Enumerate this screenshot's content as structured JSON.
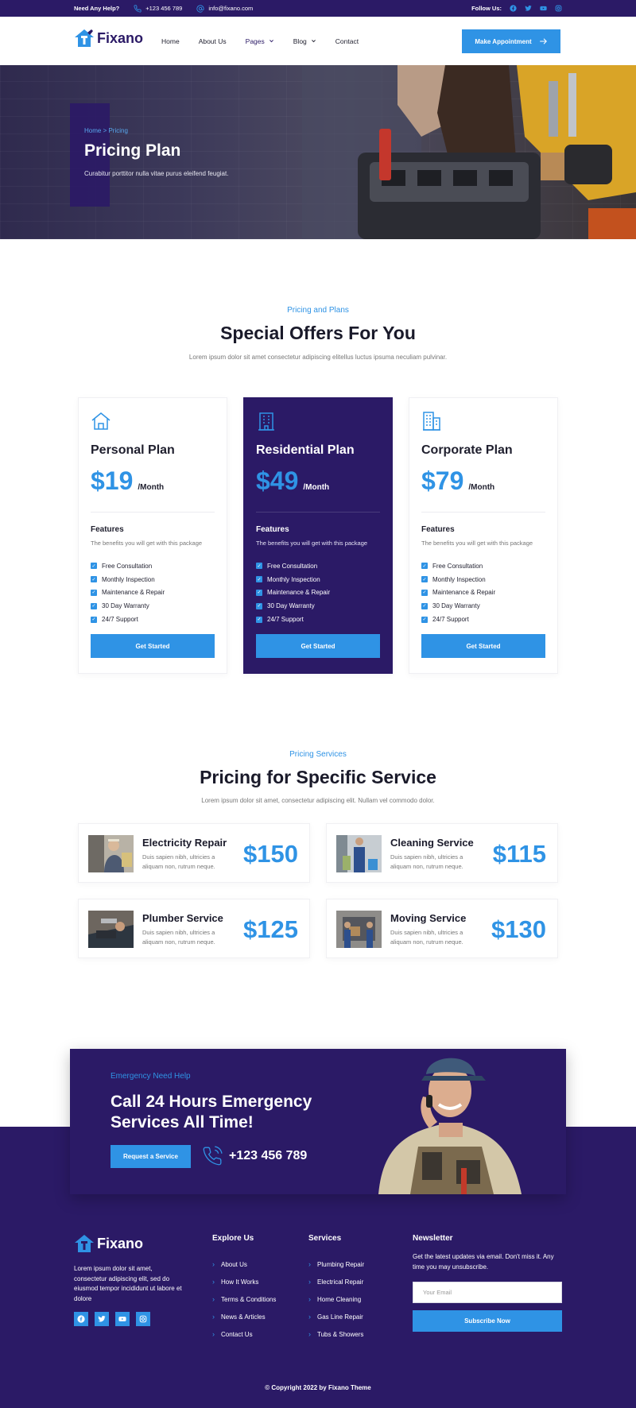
{
  "topbar": {
    "help_label": "Need Any Help?",
    "phone": "+123 456 789",
    "email": "info@fixano.com",
    "follow_label": "Follow Us:",
    "social_icons": [
      "facebook-icon",
      "twitter-icon",
      "youtube-icon",
      "instagram-icon"
    ]
  },
  "nav": {
    "logo": "Fixano",
    "items": [
      {
        "label": "Home"
      },
      {
        "label": "About Us"
      },
      {
        "label": "Pages"
      },
      {
        "label": "Blog"
      },
      {
        "label": "Contact"
      }
    ],
    "cta": "Make Appointment"
  },
  "hero": {
    "breadcrumb": "Home > Pricing",
    "title": "Pricing Plan",
    "subtitle": "Curabitur porttitor nulla vitae purus eleifend feugiat."
  },
  "pricing": {
    "tag": "Pricing and Plans",
    "title": "Special Offers For You",
    "desc": "Lorem ipsum dolor sit amet consectetur adipiscing elitellus luctus ipsuma neculiam pulvinar.",
    "plans": [
      {
        "icon": "house-icon",
        "name": "Personal Plan",
        "price": "$19",
        "period": "/Month",
        "features_title": "Features",
        "features_desc": "The benefits you will get with this package",
        "features": [
          "Free Consultation",
          "Monthly Inspection",
          "Maintenance & Repair",
          "30 Day Warranty",
          "24/7 Support"
        ],
        "button": "Get Started"
      },
      {
        "icon": "apartment-icon",
        "name": "Residential Plan",
        "price": "$49",
        "period": "/Month",
        "features_title": "Features",
        "features_desc": "The benefits you will get with this package",
        "features": [
          "Free Consultation",
          "Monthly Inspection",
          "Maintenance & Repair",
          "30 Day Warranty",
          "24/7 Support"
        ],
        "button": "Get Started"
      },
      {
        "icon": "office-buildings-icon",
        "name": "Corporate Plan",
        "price": "$79",
        "period": "/Month",
        "features_title": "Features",
        "features_desc": "The benefits you will get with this package",
        "features": [
          "Free Consultation",
          "Monthly Inspection",
          "Maintenance & Repair",
          "30 Day Warranty",
          "24/7 Support"
        ],
        "button": "Get Started"
      }
    ]
  },
  "services": {
    "tag": "Pricing Services",
    "title": "Pricing for Specific Service",
    "desc": "Lorem ipsum dolor sit amet, consectetur adipiscing elit. Nullam vel commodo dolor.",
    "items": [
      {
        "name": "Electricity Repair",
        "desc": "Duis sapien nibh, ultricies a aliquam non, rutrum neque.",
        "price": "$150"
      },
      {
        "name": "Cleaning Service",
        "desc": "Duis sapien nibh, ultricies a aliquam non, rutrum neque.",
        "price": "$115"
      },
      {
        "name": "Plumber Service",
        "desc": "Duis sapien nibh, ultricies a aliquam non, rutrum neque.",
        "price": "$125"
      },
      {
        "name": "Moving Service",
        "desc": "Duis sapien nibh, ultricies a aliquam non, rutrum neque.",
        "price": "$130"
      }
    ]
  },
  "cta": {
    "tag": "Emergency Need Help",
    "title": "Call 24 Hours Emergency Services All Time!",
    "button": "Request a Service",
    "phone": "+123 456 789"
  },
  "footer": {
    "logo": "Fixano",
    "about": "Lorem ipsum dolor sit amet, consectetur adipiscing elit, sed do eiusmod tempor incididunt ut labore et dolore",
    "explore_title": "Explore Us",
    "explore_links": [
      "About Us",
      "How It Works",
      "Terms & Conditions",
      "News & Articles",
      "Contact Us"
    ],
    "services_title": "Services",
    "services_links": [
      "Plumbing Repair",
      "Electrical Repair",
      "Home Cleaning",
      "Gas Line Repair",
      "Tubs & Showers"
    ],
    "newsletter_title": "Newsletter",
    "newsletter_desc": "Get the latest updates via email. Don't miss it. Any time you may unsubscribe.",
    "email_placeholder": "Your Email",
    "subscribe": "Subscribe Now",
    "copyright": "© Copyright 2022 by Fixano Theme"
  },
  "colors": {
    "primary": "#2b1a66",
    "accent": "#2f93e5",
    "text": "#1f1f2e",
    "muted": "#777777"
  }
}
